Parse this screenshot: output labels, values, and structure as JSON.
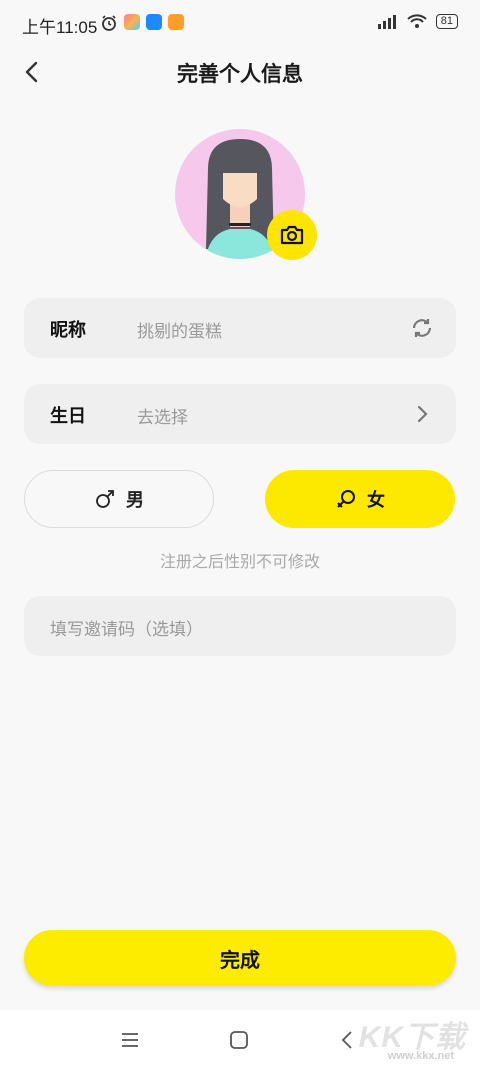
{
  "status_bar": {
    "time": "上午11:05",
    "battery": "81"
  },
  "header": {
    "title": "完善个人信息"
  },
  "form": {
    "nickname": {
      "label": "昵称",
      "value": "挑剔的蛋糕"
    },
    "birthday": {
      "label": "生日",
      "value": "去选择"
    },
    "gender": {
      "male": "男",
      "female": "女",
      "selected": "female",
      "note": "注册之后性别不可修改"
    },
    "invite": {
      "placeholder": "填写邀请码（选填）"
    }
  },
  "actions": {
    "done": "完成"
  },
  "watermark": {
    "brand": "KK下载",
    "url": "www.kkx.net"
  },
  "colors": {
    "accent": "#fde800",
    "field_bg": "#efefef",
    "avatar_bg": "#f6c8ec"
  }
}
